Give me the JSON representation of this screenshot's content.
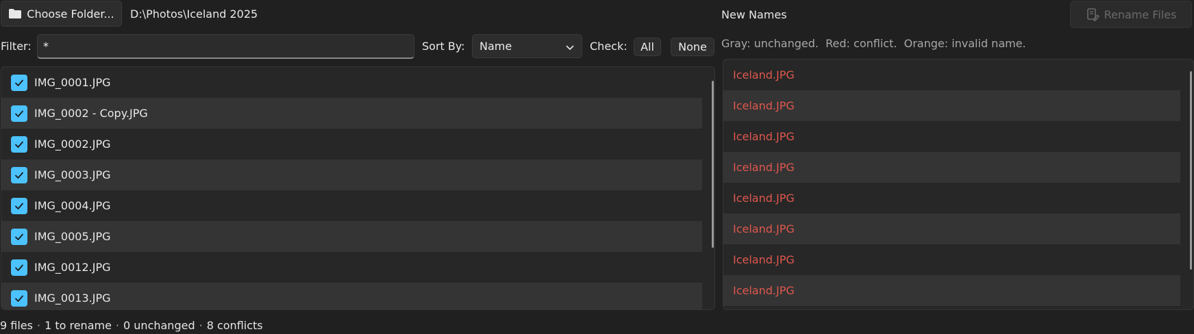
{
  "toolbar": {
    "choose_folder_label": "Choose Folder...",
    "folder_path": "D:\\Photos\\Iceland 2025",
    "new_names_heading": "New Names",
    "rename_files_label": "Rename Files"
  },
  "filter": {
    "label": "Filter:",
    "value": "*"
  },
  "sort": {
    "label": "Sort By:",
    "selected": "Name"
  },
  "check": {
    "label": "Check:",
    "all_label": "All",
    "none_label": "None"
  },
  "legend_text": "Gray: unchanged.  Red: conflict.  Orange: invalid name.",
  "files": [
    {
      "name": "IMG_0001.JPG",
      "checked": true
    },
    {
      "name": "IMG_0002 - Copy.JPG",
      "checked": true
    },
    {
      "name": "IMG_0002.JPG",
      "checked": true
    },
    {
      "name": "IMG_0003.JPG",
      "checked": true
    },
    {
      "name": "IMG_0004.JPG",
      "checked": true
    },
    {
      "name": "IMG_0005.JPG",
      "checked": true
    },
    {
      "name": "IMG_0012.JPG",
      "checked": true
    },
    {
      "name": "IMG_0013.JPG",
      "checked": true
    }
  ],
  "new_names": [
    "Iceland.JPG",
    "Iceland.JPG",
    "Iceland.JPG",
    "Iceland.JPG",
    "Iceland.JPG",
    "Iceland.JPG",
    "Iceland.JPG",
    "Iceland.JPG"
  ],
  "status": {
    "files": "9 files",
    "to_rename": "1 to rename",
    "unchanged": "0 unchanged",
    "conflicts": "8 conflicts",
    "separator": "·"
  },
  "colors": {
    "accent": "#4cc2ff",
    "conflict": "#e0574e",
    "background": "#202020"
  },
  "icons": {
    "folder": "folder-icon",
    "rename": "rename-icon",
    "chevron": "chevron-down-icon",
    "checkmark": "checkmark-icon"
  }
}
